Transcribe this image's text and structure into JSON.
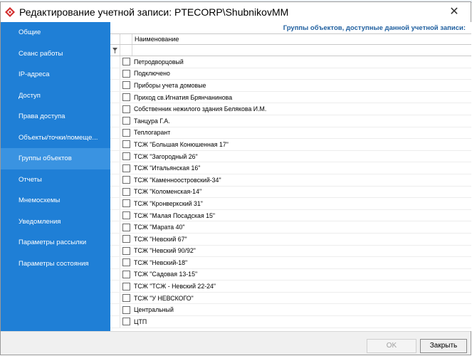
{
  "window": {
    "title": "Редактирование учетной записи: PTECORP\\ShubnikovMM",
    "accent": "#1f7fd6",
    "close_glyph": "✕"
  },
  "sidebar": {
    "items": [
      {
        "label": "Общие"
      },
      {
        "label": "Сеанс работы"
      },
      {
        "label": "IP-адреса"
      },
      {
        "label": "Доступ"
      },
      {
        "label": "Права доступа"
      },
      {
        "label": "Объекты/точки/помеще..."
      },
      {
        "label": "Группы объектов",
        "active": true
      },
      {
        "label": "Отчеты"
      },
      {
        "label": "Мнемосхемы"
      },
      {
        "label": "Уведомления"
      },
      {
        "label": "Параметры рассылки"
      },
      {
        "label": "Параметры состояния"
      }
    ]
  },
  "main": {
    "caption": "Группы объектов, доступные данной учетной записи:",
    "column_header": "Наименование",
    "filter_icon": "filter-pin-icon",
    "rows": [
      "Петродворцовый",
      "Подключено",
      "Приборы учета домовые",
      "Приход св.Игнатия Брянчанинова",
      "Собственник нежилого здания Белякова И.М.",
      "Танцура Г.А.",
      "Теплогарант",
      "ТСЖ \"Большая Конюшенная 17\"",
      "ТСЖ \"Загородный 26\"",
      "ТСЖ \"Итальянская 16\"",
      "ТСЖ \"Каменноостровский-34\"",
      "ТСЖ \"Коломенская-14\"",
      "ТСЖ \"Кронверкский 31\"",
      "ТСЖ \"Малая Посадская 15\"",
      "ТСЖ \"Марата 40\"",
      "ТСЖ \"Невский 67\"",
      "ТСЖ \"Невский 90/92\"",
      "ТСЖ \"Невский-18\"",
      "ТСЖ \"Садовая 13-15\"",
      "ТСЖ \"ТСЖ - Невский 22-24\"",
      "ТСЖ \"У НЕВСКОГО\"",
      "Центральный",
      "ЦТП"
    ]
  },
  "footer": {
    "ok_label": "OK",
    "close_label": "Закрыть"
  }
}
